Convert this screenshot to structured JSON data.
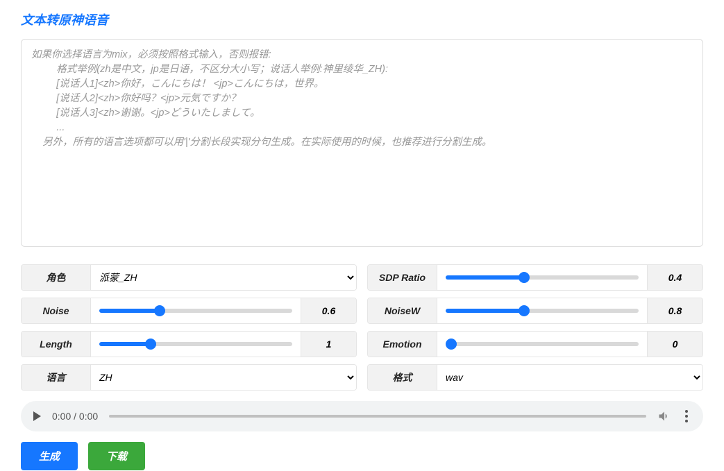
{
  "header": {
    "title": "文本转原神语音"
  },
  "textarea": {
    "placeholder": "如果你选择语言为mix，必须按照格式输入，否则报错:\n         格式举例(zh是中文，jp是日语，不区分大小写；说话人举例:神里绫华_ZH):\n         [说话人1]<zh>你好，こんにちは！ <jp>こんにちは，世界。\n         [说话人2]<zh>你好吗？<jp>元気ですか？\n         [说话人3]<zh>谢谢。<jp>どういたしまして。\n         ...\n    另外，所有的语言选项都可以用'|'分割长段实现分句生成。在实际使用的时候，也推荐进行分割生成。",
    "value": ""
  },
  "controls": {
    "role": {
      "label": "角色",
      "selected": "派蒙_ZH"
    },
    "sdp": {
      "label": "SDP Ratio",
      "value": "0.4",
      "min": 0,
      "max": 1
    },
    "noise": {
      "label": "Noise",
      "value": "0.6",
      "min": 0,
      "max": 2
    },
    "noisew": {
      "label": "NoiseW",
      "value": "0.8",
      "min": 0,
      "max": 2
    },
    "length": {
      "label": "Length",
      "value": "1",
      "min": 0,
      "max": 4
    },
    "emotion": {
      "label": "Emotion",
      "value": "0",
      "min": 0,
      "max": 10
    },
    "language": {
      "label": "语言",
      "selected": "ZH"
    },
    "format": {
      "label": "格式",
      "selected": "wav"
    }
  },
  "audio": {
    "time": "0:00 / 0:00"
  },
  "buttons": {
    "generate": "生成",
    "download": "下载"
  }
}
